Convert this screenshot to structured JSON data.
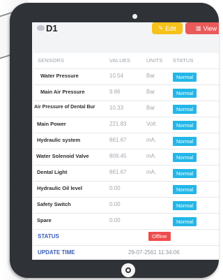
{
  "device": {
    "title": "D1",
    "edit_label": "Edit",
    "view_label": "View",
    "edit_icon": "edit-icon",
    "view_icon": "chart-icon"
  },
  "table": {
    "headers": {
      "sensor": "SENSORS",
      "value": "VALUES",
      "unit": "UNITS",
      "status": "STATUS"
    },
    "rows": [
      {
        "sensor": "Water Pressure",
        "value": "10.54",
        "unit": "Bar",
        "status": "Normal"
      },
      {
        "sensor": "Main Air Pressure",
        "value": "9.86",
        "unit": "Bar",
        "status": "Normal"
      },
      {
        "sensor": "Air Pressure of Dental Bur",
        "value": "10.33",
        "unit": "Bar",
        "status": "Normal"
      },
      {
        "sensor": "Main Power",
        "value": "221.83",
        "unit": "Volt",
        "status": "Normal"
      },
      {
        "sensor": "Hydraulic system",
        "value": "861.67",
        "unit": "mA.",
        "status": "Normal"
      },
      {
        "sensor": "Water Solenoid Valve",
        "value": "809.45",
        "unit": "mA.",
        "status": "Normal"
      },
      {
        "sensor": "Dental Light",
        "value": "861.67",
        "unit": "mA.",
        "status": "Normal"
      },
      {
        "sensor": "Hydraulic Oil level",
        "value": "0.00",
        "unit": "",
        "status": "Normal"
      },
      {
        "sensor": "Safety Switch",
        "value": "0.00",
        "unit": "",
        "status": "Normal"
      },
      {
        "sensor": "Spare",
        "value": "0.00",
        "unit": "",
        "status": "Normal"
      }
    ]
  },
  "status": {
    "label": "STATUS",
    "value": "Offline"
  },
  "update": {
    "label": "UPDATE TIME",
    "value": "29-07-2561 11:34:06"
  },
  "colors": {
    "normal_badge": "#22b7e8",
    "offline_badge": "#ee4c4c",
    "edit_button": "#f6c21b",
    "view_button": "#ea5a5a",
    "footer_label": "#3a5db8"
  }
}
